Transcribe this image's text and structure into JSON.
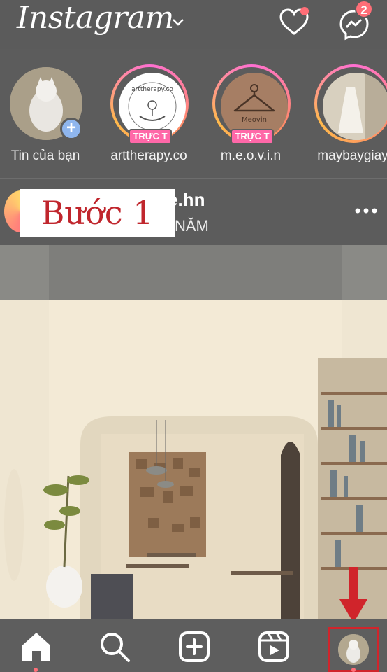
{
  "header": {
    "app_name": "Instagram",
    "messages_badge": "2"
  },
  "stories": [
    {
      "label": "Tin của bạn",
      "live": ""
    },
    {
      "label": "arttherapy.co",
      "live": "TRỰC T"
    },
    {
      "label": "m.e.o.v.i.n",
      "live": "TRỰC T"
    },
    {
      "label": "maybaygiay",
      "live": ""
    }
  ],
  "story_avatar_text": {
    "arttherapy": "arttherapy.co",
    "meovin": "Meovin"
  },
  "post": {
    "username": "e.hn",
    "subtitle": "NĂM"
  },
  "annotation": {
    "step": "Bước 1"
  },
  "colors": {
    "overlay": "#5c5c5c",
    "highlight": "#d0242b",
    "badge": "#ff6e77",
    "live": "#ff68a8"
  }
}
